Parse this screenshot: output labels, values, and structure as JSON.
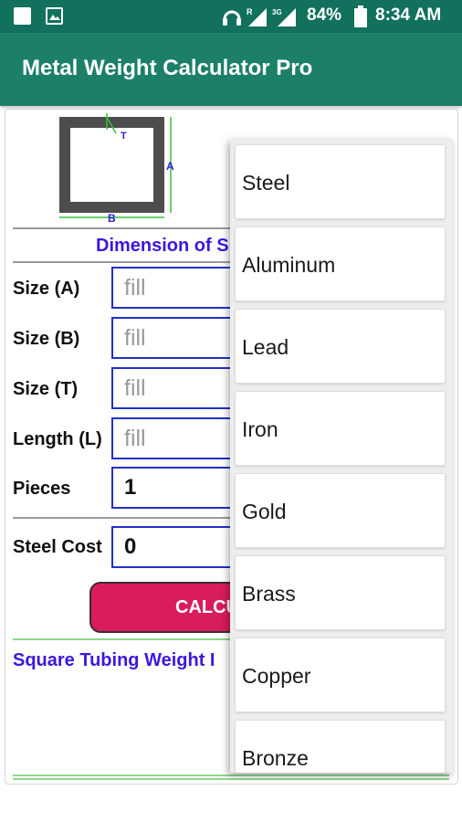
{
  "status_bar": {
    "battery": "84%",
    "time": "8:34 AM",
    "network_badge": "3G",
    "roaming_badge": "R"
  },
  "app_bar": {
    "title": "Metal Weight Calculator Pro",
    "color": "#1c8069"
  },
  "diagram": {
    "label_a": "A",
    "label_b": "B",
    "label_t": "T"
  },
  "form": {
    "section_heading": "Dimension of S",
    "fields": [
      {
        "label": "Size (A)",
        "placeholder": "fill",
        "value": ""
      },
      {
        "label": "Size (B)",
        "placeholder": "fill",
        "value": ""
      },
      {
        "label": "Size (T)",
        "placeholder": "fill",
        "value": ""
      },
      {
        "label": "Length (L)",
        "placeholder": "fill",
        "value": ""
      },
      {
        "label": "Pieces",
        "placeholder": "",
        "value": "1"
      }
    ],
    "cost": {
      "label": "Steel Cost",
      "value": "0"
    },
    "calculate_label": "CALCU",
    "result_title": "Square Tubing Weight I"
  },
  "dropdown": {
    "options": [
      "Steel",
      "Aluminum",
      "Lead",
      "Iron",
      "Gold",
      "Brass",
      "Copper",
      "Bronze"
    ]
  },
  "colors": {
    "status_bar": "#12715d",
    "heading": "#3d17dd",
    "button": "#d81c5c",
    "input_border": "#2230c8",
    "divider_green": "#8fd68f"
  }
}
